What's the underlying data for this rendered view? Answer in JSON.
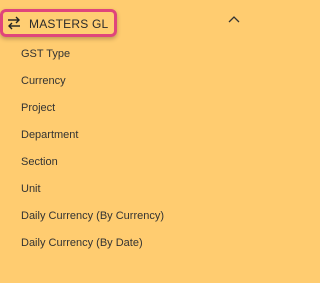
{
  "masters_gl": {
    "title": "MASTERS GL",
    "icon": "swap-arrows-icon",
    "collapse_icon": "chevron-up-icon",
    "items": [
      {
        "label": "GST Type"
      },
      {
        "label": "Currency"
      },
      {
        "label": "Project"
      },
      {
        "label": "Department"
      },
      {
        "label": "Section"
      },
      {
        "label": "Unit"
      },
      {
        "label": "Daily Currency (By Currency)"
      },
      {
        "label": "Daily Currency (By Date)"
      }
    ]
  },
  "colors": {
    "background": "#ffcc70",
    "highlight_border": "#e0457b",
    "text": "#333333"
  }
}
